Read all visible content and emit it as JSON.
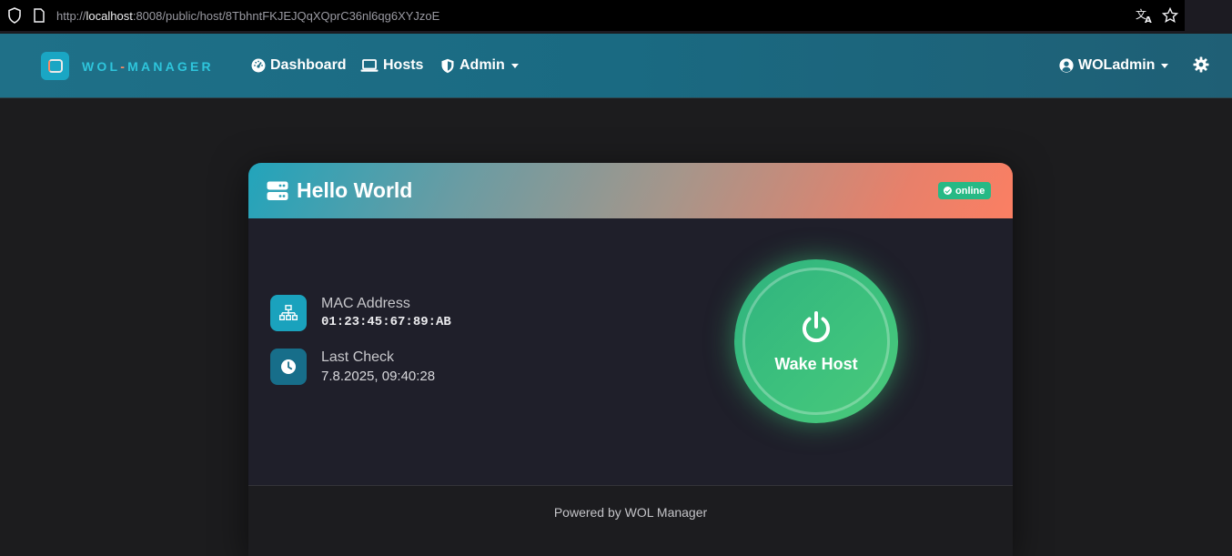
{
  "browser": {
    "url_prefix": "http://",
    "url_host": "localhost",
    "url_rest": ":8008/public/host/8TbhntFKJEJQqXQprC36nl6qg6XYJzoE"
  },
  "navbar": {
    "brand_left": "WOL",
    "brand_dash": "-",
    "brand_right": "MANAGER",
    "items": [
      {
        "label": "Dashboard",
        "icon": "dashboard-icon"
      },
      {
        "label": "Hosts",
        "icon": "laptop-icon"
      },
      {
        "label": "Admin",
        "icon": "shield-icon"
      }
    ],
    "user": "WOLadmin"
  },
  "card": {
    "title": "Hello World",
    "status": "online",
    "mac_label": "MAC Address",
    "mac_value": "01:23:45:67:89:AB",
    "last_check_label": "Last Check",
    "last_check_value": "7.8.2025, 09:40:28",
    "wake_label": "Wake Host",
    "footer": "Powered by WOL Manager"
  },
  "colors": {
    "accent": "#1aa6c4",
    "online": "#27b985",
    "wake": "#3ec27d",
    "header_start": "#22a4bb",
    "header_end": "#fb7f63"
  }
}
